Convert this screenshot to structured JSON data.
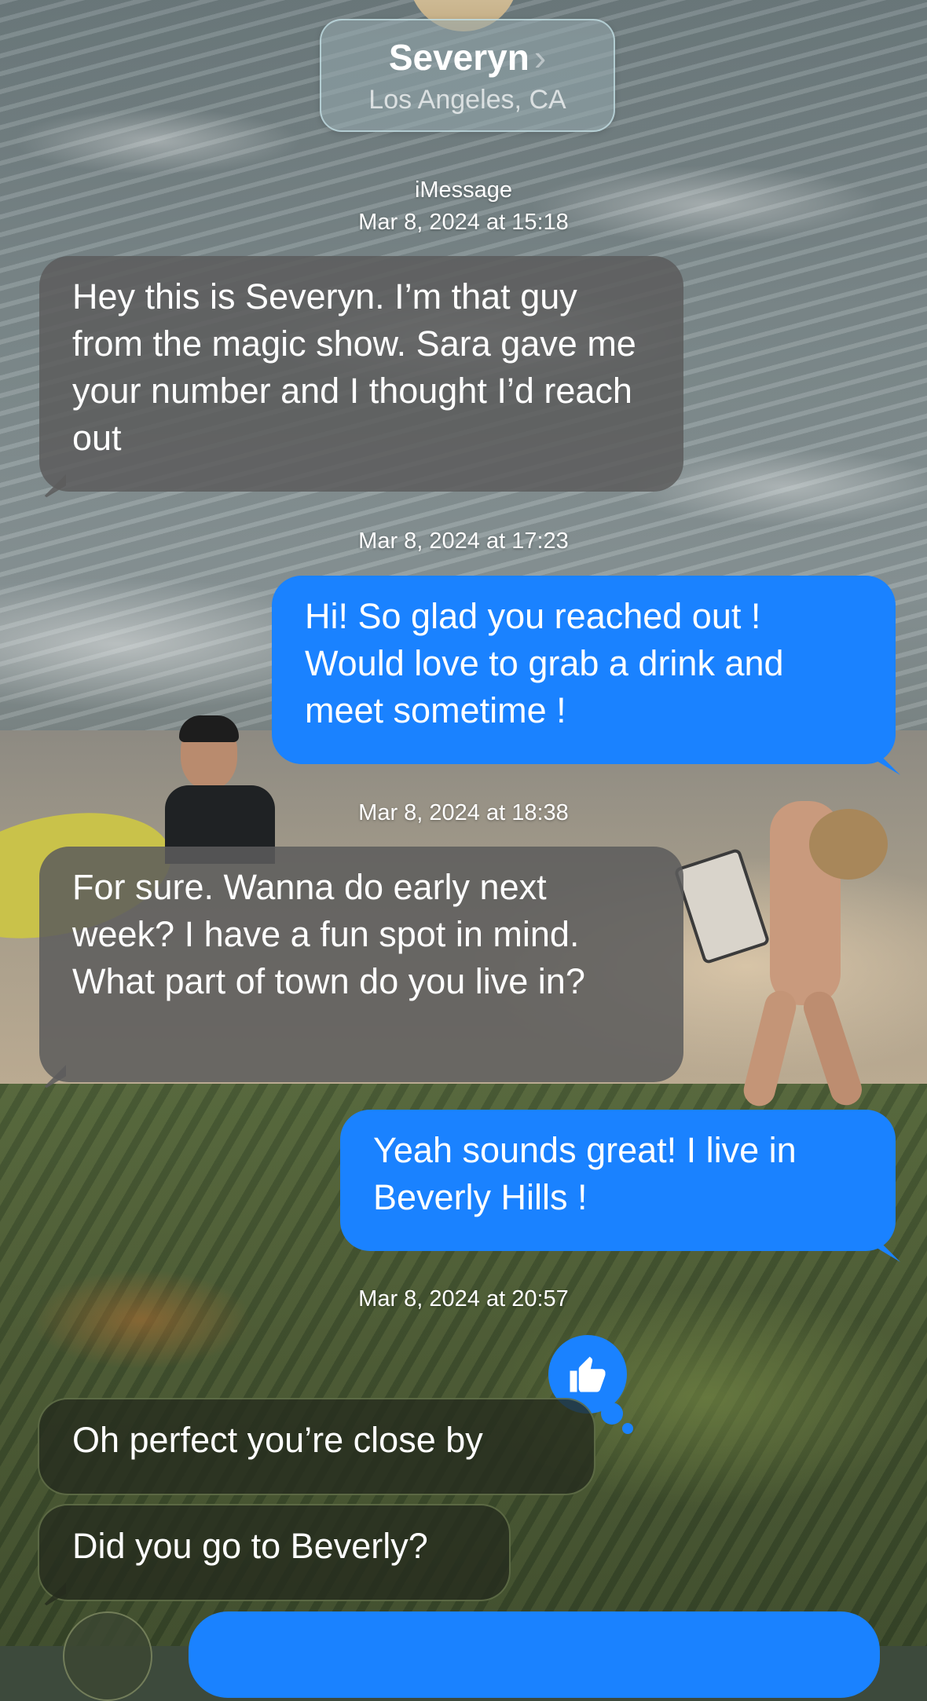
{
  "header": {
    "contact_name": "Severyn",
    "chevron": "›",
    "location": "Los Angeles, CA"
  },
  "thread": {
    "service_label": "iMessage",
    "stamps": [
      "Mar 8, 2024 at 15:18",
      "Mar 8, 2024 at 17:23",
      "Mar 8, 2024 at 18:38",
      "Mar 8, 2024 at 20:57"
    ],
    "messages": [
      {
        "direction": "incoming",
        "text": "Hey this is Severyn. I’m that guy from the magic show. Sara gave me your number and I thought I’d reach out"
      },
      {
        "direction": "outgoing",
        "text": "Hi! So glad you reached out ! Would love to grab a drink and meet sometime !"
      },
      {
        "direction": "incoming",
        "text": "For sure. Wanna do early next week? I have a fun spot in mind. What part of town do you live in?"
      },
      {
        "direction": "outgoing",
        "text": "Yeah sounds great! I live in Beverly Hills !"
      },
      {
        "direction": "incoming",
        "text": "Oh perfect you’re close by",
        "reaction": "thumbs-up-icon"
      },
      {
        "direction": "incoming",
        "text": "Did you go to Beverly?"
      }
    ]
  },
  "colors": {
    "outgoing_bubble": "#1a82ff",
    "incoming_bubble": "#5c5c5c",
    "text": "#ffffff"
  }
}
